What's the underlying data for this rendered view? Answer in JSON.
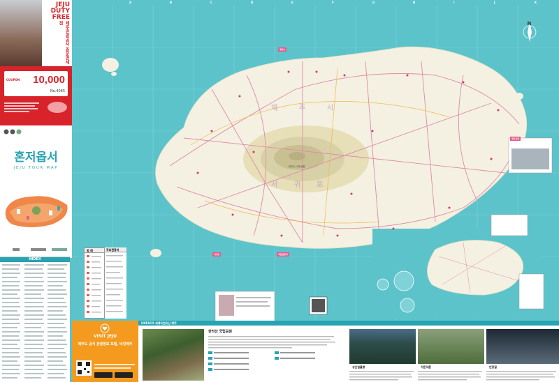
{
  "ad": {
    "brand": "JEJU DUTY FREE",
    "sub": "제주관광공사 중문면세점",
    "coupon_label": "COUPON",
    "coupon_value": "10,000",
    "coupon_no": "No.4065",
    "colors": {
      "red": "#d8232a",
      "white": "#ffffff"
    }
  },
  "title": {
    "main": "혼저옵서",
    "sub": "JEJU TOUR MAP"
  },
  "index": {
    "header": "INDEX"
  },
  "legend": {
    "header": "범 례",
    "header2": "주요관광지"
  },
  "visit_jeju": {
    "title": "VISIT JEJU",
    "desc": "제주도 공식 관광정보 포털, 비짓제주"
  },
  "bottom": {
    "unesco_bar": "UNESCO 세계자연유산 제주",
    "hallasan_title": "한라산 국립공원",
    "captions": [
      "성산일출봉",
      "거문오름",
      "만장굴"
    ]
  },
  "map": {
    "north": "N",
    "grid_letters": [
      "A",
      "B",
      "C",
      "D",
      "E",
      "F",
      "G",
      "H",
      "I",
      "J",
      "K",
      "L"
    ],
    "districts": [
      "제",
      "주",
      "시",
      "서",
      "귀",
      "포"
    ],
    "peak_label": "한라산 국립공원",
    "boxes": [
      "제주시",
      "서귀포",
      "추천관광지",
      "제주공항"
    ],
    "colors": {
      "sea": "#5cc3cb",
      "land": "#f4f1e2",
      "forest": "#d8d1a8",
      "roads": "#e08aa8"
    }
  }
}
